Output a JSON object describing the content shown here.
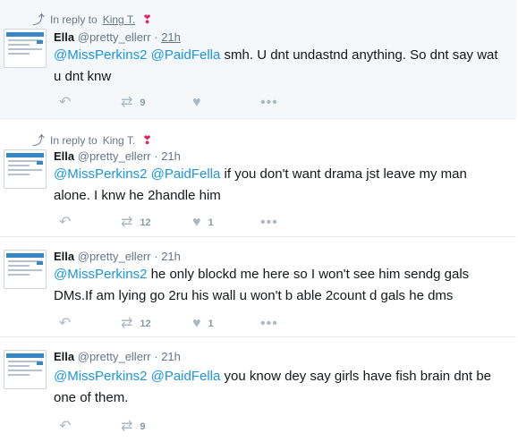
{
  "tweets": [
    {
      "reply_prefix": "In reply to",
      "reply_to": "King T.",
      "name": "Ella",
      "handle": "@pretty_ellerr",
      "time": "21h",
      "mentions": [
        "@MissPerkins2",
        "@PaidFella"
      ],
      "text": " smh. U dnt undastnd anything. So dnt say wat u dnt knw",
      "retweets": "9",
      "likes": ""
    },
    {
      "reply_prefix": "In reply to",
      "reply_to": "King T.",
      "name": "Ella",
      "handle": "@pretty_ellerr",
      "time": "21h",
      "mentions": [
        "@MissPerkins2",
        "@PaidFella"
      ],
      "text": " if you don't want drama jst leave my man alone. I knw he 2handle him",
      "retweets": "12",
      "likes": "1"
    },
    {
      "name": "Ella",
      "handle": "@pretty_ellerr",
      "time": "21h",
      "mentions": [
        "@MissPerkins2"
      ],
      "text": "  he only blockd me here so I won't see him sendg gals DMs.If am lying go 2ru his wall u won't b able 2count d gals he dms",
      "retweets": "12",
      "likes": "1"
    },
    {
      "name": "Ella",
      "handle": "@pretty_ellerr",
      "time": "21h",
      "mentions": [
        "@MissPerkins2",
        "@PaidFella"
      ],
      "text": " you know dey say girls have fish brain dnt be one of them.",
      "retweets": "9",
      "likes": ""
    }
  ],
  "icons": {
    "reply": "reply-arrow",
    "retweet": "retweet-arrows",
    "like": "heart",
    "more": "ellipsis",
    "badge": "red-heart-emoji"
  },
  "colors": {
    "mention": "#1b95e0",
    "highlight_bg": "#f5f8fa",
    "muted": "#657786",
    "badge": "#e0245e"
  }
}
